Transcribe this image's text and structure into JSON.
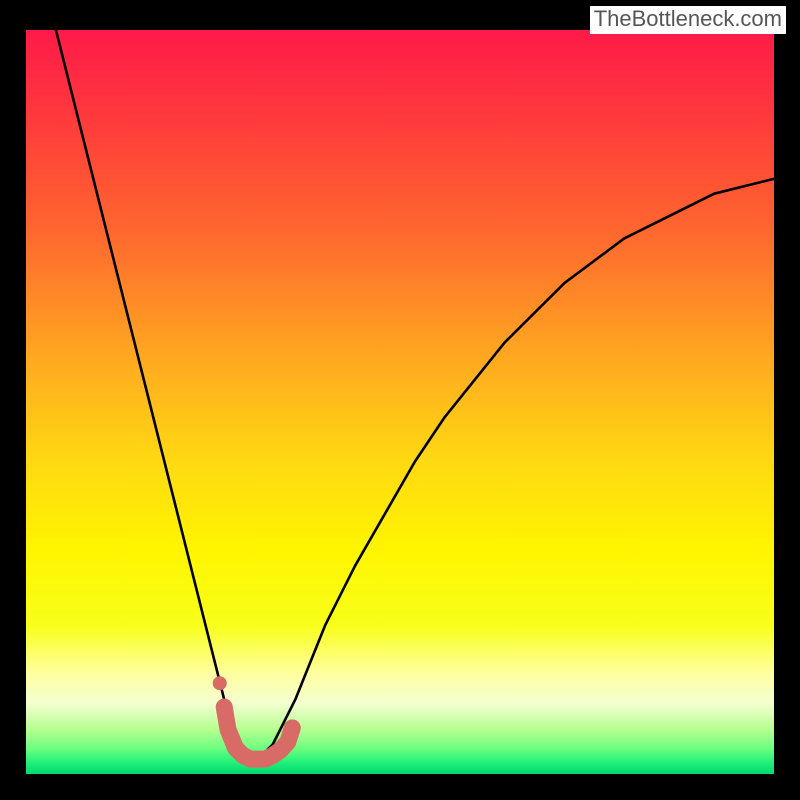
{
  "watermark": "TheBottleneck.com",
  "colors": {
    "black": "#000000",
    "curve": "#000000",
    "marker": "#d86b66",
    "gradient_stops": [
      {
        "offset": 0.0,
        "color": "#ff1a49"
      },
      {
        "offset": 0.12,
        "color": "#ff3a3c"
      },
      {
        "offset": 0.28,
        "color": "#ff6a2e"
      },
      {
        "offset": 0.44,
        "color": "#ffa820"
      },
      {
        "offset": 0.58,
        "color": "#ffd912"
      },
      {
        "offset": 0.7,
        "color": "#fff500"
      },
      {
        "offset": 0.8,
        "color": "#f8ff1a"
      },
      {
        "offset": 0.865,
        "color": "#ffffa0"
      },
      {
        "offset": 0.905,
        "color": "#f4ffd0"
      },
      {
        "offset": 0.94,
        "color": "#b6ff90"
      },
      {
        "offset": 0.965,
        "color": "#6Fff80"
      },
      {
        "offset": 0.985,
        "color": "#20f078"
      },
      {
        "offset": 1.0,
        "color": "#00d873"
      }
    ]
  },
  "chart_data": {
    "type": "line",
    "title": "",
    "xlabel": "",
    "ylabel": "",
    "xlim": [
      0,
      100
    ],
    "ylim": [
      0,
      100
    ],
    "note": "V-shaped bottleneck curve over a vertical red→green gradient. Axis labels and tick marks are not shown in the image; x/y values are estimated from pixel positions mapped to a 0–100 scale.",
    "series": [
      {
        "name": "bottleneck-curve",
        "x": [
          4,
          6,
          8,
          10,
          12,
          14,
          16,
          18,
          20,
          22,
          24,
          25,
          26,
          27,
          28,
          29,
          30,
          31,
          32,
          33,
          34,
          36,
          38,
          40,
          44,
          48,
          52,
          56,
          60,
          64,
          68,
          72,
          76,
          80,
          84,
          88,
          92,
          96,
          100
        ],
        "y": [
          100,
          92,
          84,
          76,
          68,
          60,
          52,
          44,
          36,
          28,
          20,
          16,
          12,
          8,
          5,
          3,
          2,
          2,
          3,
          4,
          6,
          10,
          15,
          20,
          28,
          35,
          42,
          48,
          53,
          58,
          62,
          66,
          69,
          72,
          74,
          76,
          78,
          79,
          80
        ]
      }
    ],
    "markers": {
      "name": "curve-bottom-highlight",
      "color": "#d86b66",
      "points_x": [
        26.5,
        27,
        28,
        29,
        30,
        31,
        32,
        33,
        34,
        35,
        35.6
      ],
      "points_y": [
        9,
        6,
        3.5,
        2.5,
        2,
        2,
        2,
        2.5,
        3.2,
        4.3,
        6.2
      ]
    }
  }
}
